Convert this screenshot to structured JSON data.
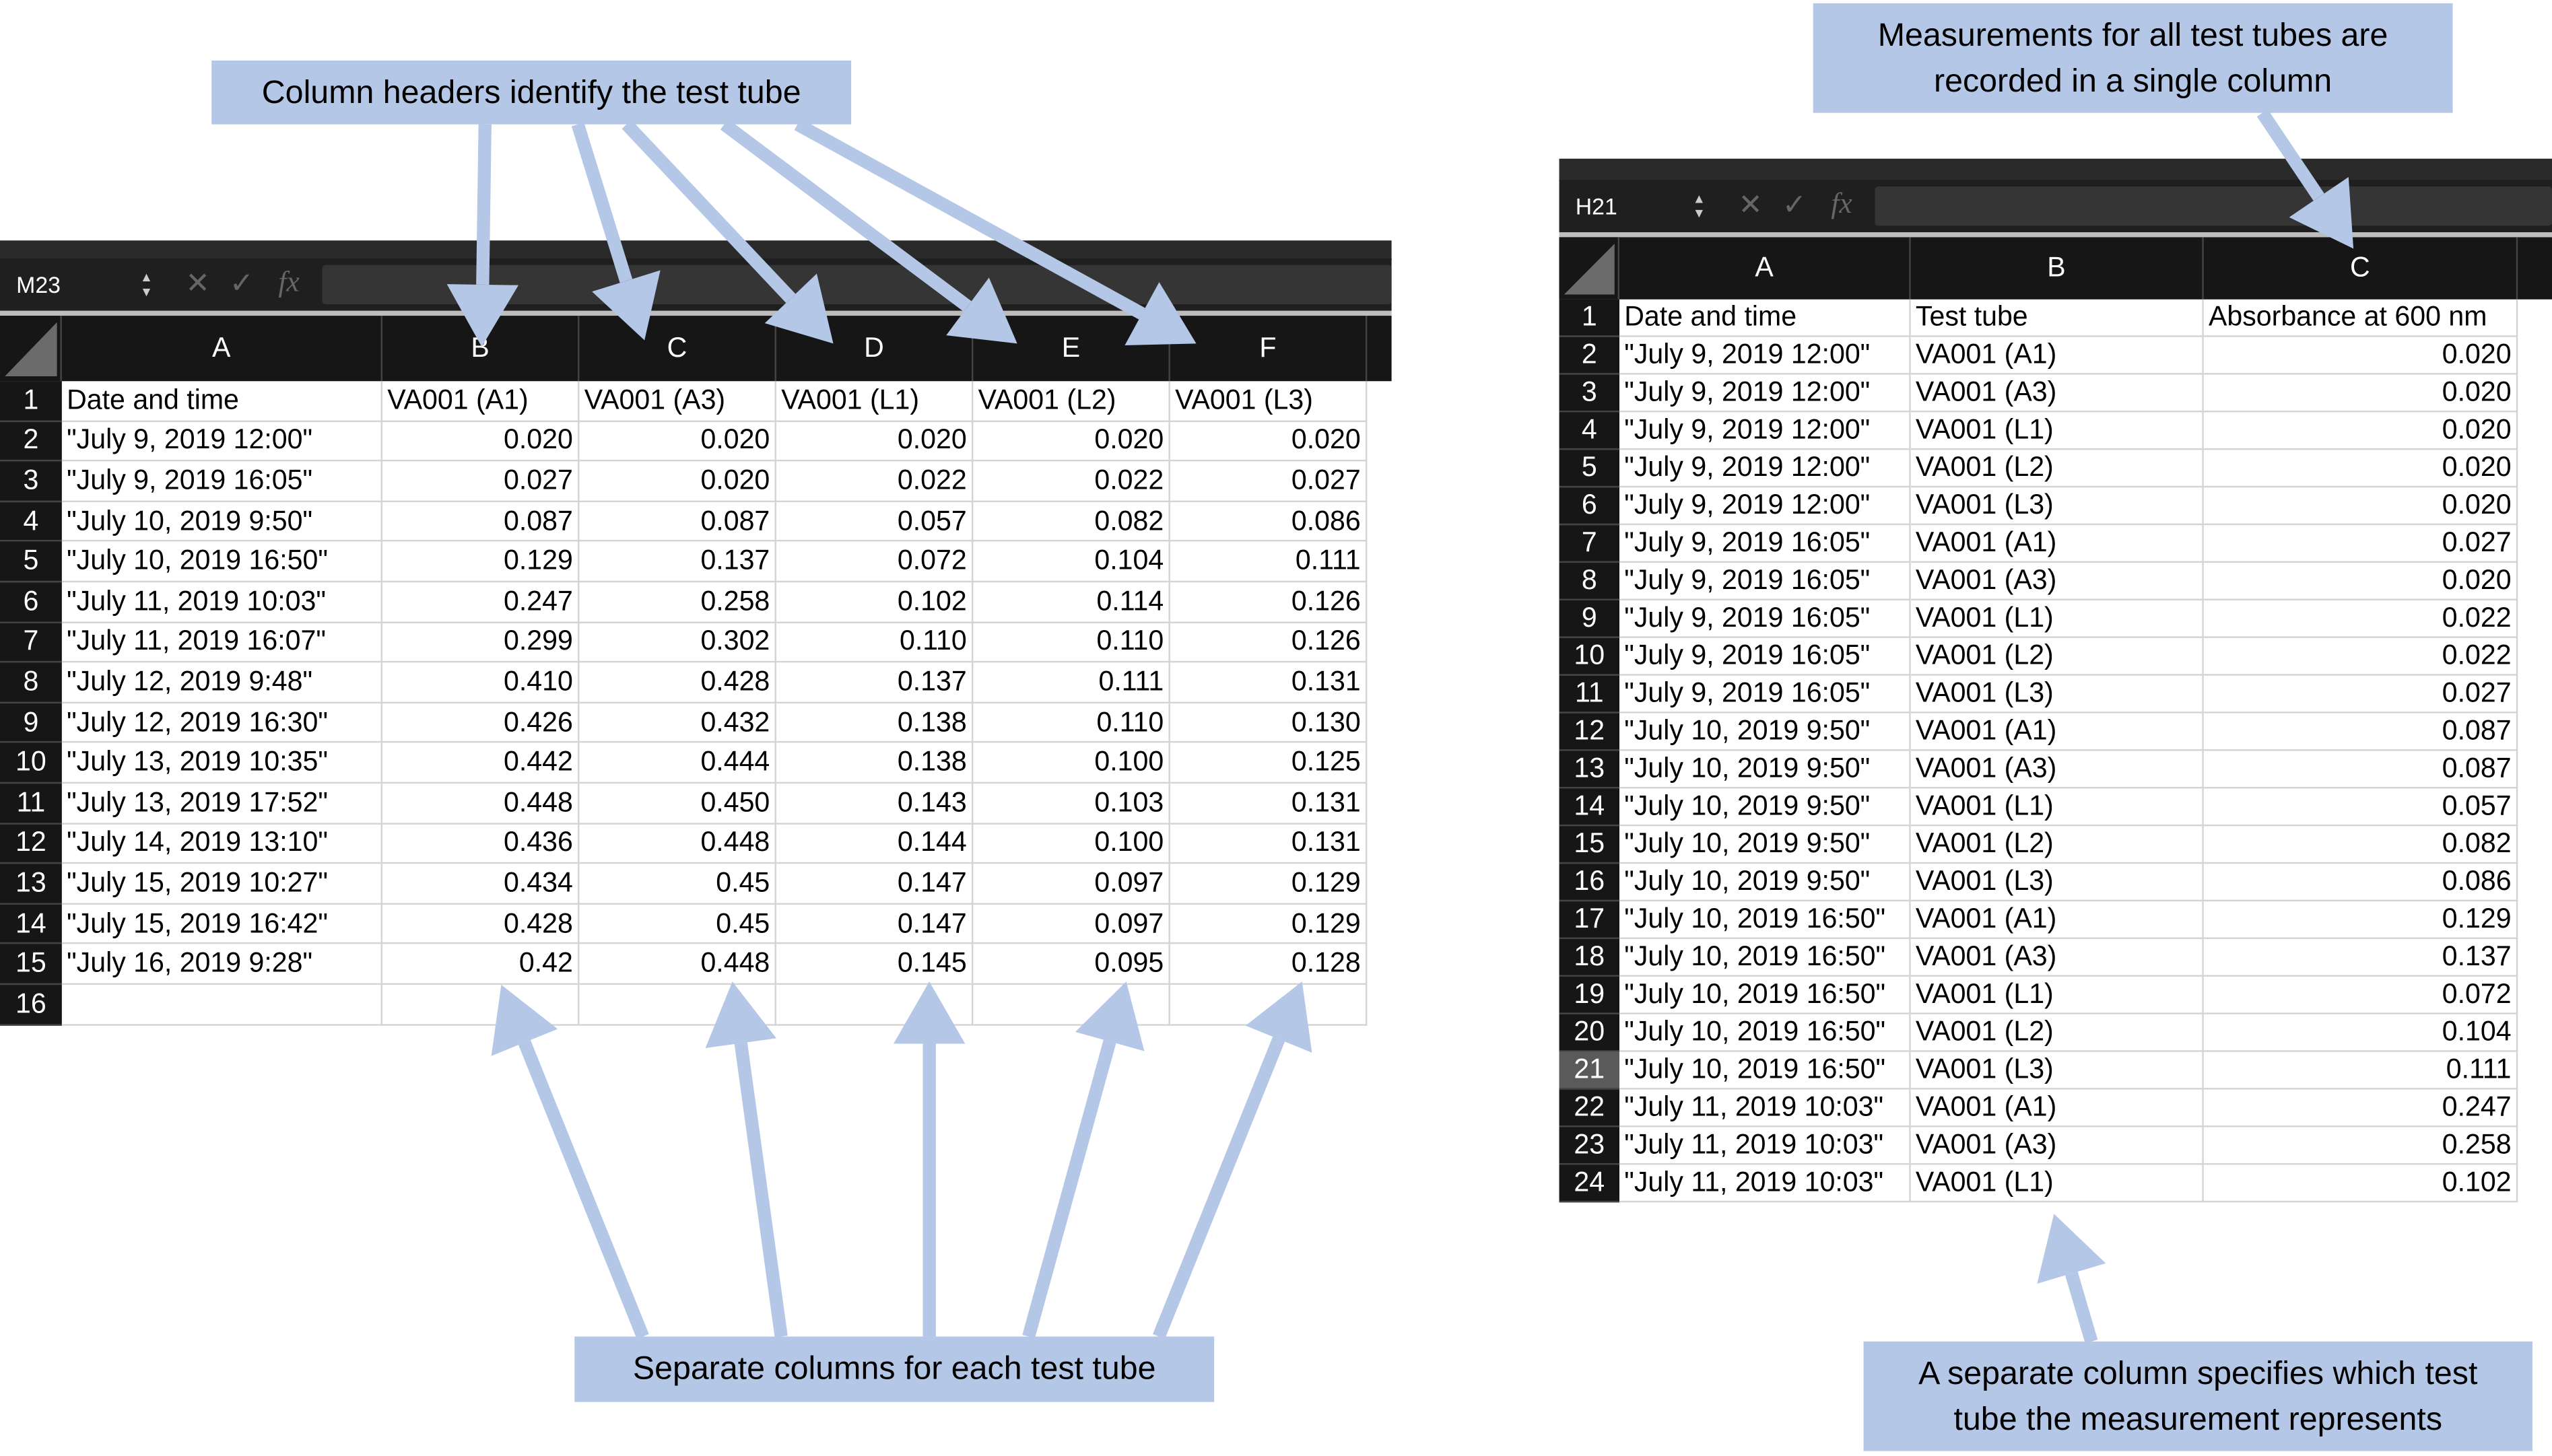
{
  "colors": {
    "callout": "#b4c7e7",
    "arrow": "#b4c7e7",
    "header_bg": "#161616",
    "selected_row": "#5a5a5a"
  },
  "formula_icons": {
    "cancel": "✕",
    "confirm": "✓",
    "fx": "fx",
    "stepper_up": "▲",
    "stepper_down": "▼"
  },
  "wide_sheet": {
    "name_box": "M23",
    "columns": [
      "A",
      "B",
      "C",
      "D",
      "E",
      "F"
    ],
    "rows": [
      {
        "n": "1",
        "cells": [
          "Date and time",
          "VA001 (A1)",
          "VA001 (A3)",
          "VA001 (L1)",
          "VA001 (L2)",
          "VA001 (L3)"
        ]
      },
      {
        "n": "2",
        "cells": [
          "\"July 9, 2019  12:00\"",
          "0.020",
          "0.020",
          "0.020",
          "0.020",
          "0.020"
        ]
      },
      {
        "n": "3",
        "cells": [
          "\"July 9, 2019 16:05\"",
          "0.027",
          "0.020",
          "0.022",
          "0.022",
          "0.027"
        ]
      },
      {
        "n": "4",
        "cells": [
          "\"July 10, 2019 9:50\"",
          "0.087",
          "0.087",
          "0.057",
          "0.082",
          "0.086"
        ]
      },
      {
        "n": "5",
        "cells": [
          "\"July 10, 2019 16:50\"",
          "0.129",
          "0.137",
          "0.072",
          "0.104",
          "0.111"
        ]
      },
      {
        "n": "6",
        "cells": [
          "\"July 11, 2019 10:03\"",
          "0.247",
          "0.258",
          "0.102",
          "0.114",
          "0.126"
        ]
      },
      {
        "n": "7",
        "cells": [
          "\"July 11, 2019 16:07\"",
          "0.299",
          "0.302",
          "0.110",
          "0.110",
          "0.126"
        ]
      },
      {
        "n": "8",
        "cells": [
          "\"July 12, 2019 9:48\"",
          "0.410",
          "0.428",
          "0.137",
          "0.111",
          "0.131"
        ]
      },
      {
        "n": "9",
        "cells": [
          "\"July 12, 2019 16:30\"",
          "0.426",
          "0.432",
          "0.138",
          "0.110",
          "0.130"
        ]
      },
      {
        "n": "10",
        "cells": [
          "\"July 13, 2019 10:35\"",
          "0.442",
          "0.444",
          "0.138",
          "0.100",
          "0.125"
        ]
      },
      {
        "n": "11",
        "cells": [
          "\"July 13, 2019 17:52\"",
          "0.448",
          "0.450",
          "0.143",
          "0.103",
          "0.131"
        ]
      },
      {
        "n": "12",
        "cells": [
          "\"July 14, 2019 13:10\"",
          "0.436",
          "0.448",
          "0.144",
          "0.100",
          "0.131"
        ]
      },
      {
        "n": "13",
        "cells": [
          "\"July 15, 2019 10:27\"",
          "0.434",
          "0.45",
          "0.147",
          "0.097",
          "0.129"
        ]
      },
      {
        "n": "14",
        "cells": [
          "\"July 15, 2019 16:42\"",
          "0.428",
          "0.45",
          "0.147",
          "0.097",
          "0.129"
        ]
      },
      {
        "n": "15",
        "cells": [
          "\"July 16, 2019 9:28\"",
          "0.42",
          "0.448",
          "0.145",
          "0.095",
          "0.128"
        ]
      },
      {
        "n": "16",
        "cells": [
          "",
          "",
          "",
          "",
          "",
          ""
        ]
      }
    ]
  },
  "long_sheet": {
    "name_box": "H21",
    "selected_row": "21",
    "columns": [
      "A",
      "B",
      "C"
    ],
    "rows": [
      {
        "n": "1",
        "cells": [
          "Date and time",
          "Test tube",
          "Absorbance at 600 nm"
        ]
      },
      {
        "n": "2",
        "cells": [
          "\"July 9, 2019  12:00\"",
          "VA001 (A1)",
          "0.020"
        ]
      },
      {
        "n": "3",
        "cells": [
          "\"July 9, 2019  12:00\"",
          "VA001 (A3)",
          "0.020"
        ]
      },
      {
        "n": "4",
        "cells": [
          "\"July 9, 2019  12:00\"",
          "VA001 (L1)",
          "0.020"
        ]
      },
      {
        "n": "5",
        "cells": [
          "\"July 9, 2019  12:00\"",
          "VA001 (L2)",
          "0.020"
        ]
      },
      {
        "n": "6",
        "cells": [
          "\"July 9, 2019  12:00\"",
          "VA001 (L3)",
          "0.020"
        ]
      },
      {
        "n": "7",
        "cells": [
          "\"July 9, 2019 16:05\"",
          "VA001 (A1)",
          "0.027"
        ]
      },
      {
        "n": "8",
        "cells": [
          "\"July 9, 2019 16:05\"",
          "VA001 (A3)",
          "0.020"
        ]
      },
      {
        "n": "9",
        "cells": [
          "\"July 9, 2019 16:05\"",
          "VA001 (L1)",
          "0.022"
        ]
      },
      {
        "n": "10",
        "cells": [
          "\"July 9, 2019 16:05\"",
          "VA001 (L2)",
          "0.022"
        ]
      },
      {
        "n": "11",
        "cells": [
          "\"July 9, 2019 16:05\"",
          "VA001 (L3)",
          "0.027"
        ]
      },
      {
        "n": "12",
        "cells": [
          "\"July 10, 2019 9:50\"",
          "VA001 (A1)",
          "0.087"
        ]
      },
      {
        "n": "13",
        "cells": [
          "\"July 10, 2019 9:50\"",
          "VA001 (A3)",
          "0.087"
        ]
      },
      {
        "n": "14",
        "cells": [
          "\"July 10, 2019 9:50\"",
          "VA001 (L1)",
          "0.057"
        ]
      },
      {
        "n": "15",
        "cells": [
          "\"July 10, 2019 9:50\"",
          "VA001 (L2)",
          "0.082"
        ]
      },
      {
        "n": "16",
        "cells": [
          "\"July 10, 2019 9:50\"",
          "VA001 (L3)",
          "0.086"
        ]
      },
      {
        "n": "17",
        "cells": [
          "\"July 10, 2019 16:50\"",
          "VA001 (A1)",
          "0.129"
        ]
      },
      {
        "n": "18",
        "cells": [
          "\"July 10, 2019 16:50\"",
          "VA001 (A3)",
          "0.137"
        ]
      },
      {
        "n": "19",
        "cells": [
          "\"July 10, 2019 16:50\"",
          "VA001 (L1)",
          "0.072"
        ]
      },
      {
        "n": "20",
        "cells": [
          "\"July 10, 2019 16:50\"",
          "VA001 (L2)",
          "0.104"
        ]
      },
      {
        "n": "21",
        "cells": [
          "\"July 10, 2019 16:50\"",
          "VA001 (L3)",
          "0.111"
        ]
      },
      {
        "n": "22",
        "cells": [
          "\"July 11, 2019 10:03\"",
          "VA001 (A1)",
          "0.247"
        ]
      },
      {
        "n": "23",
        "cells": [
          "\"July 11, 2019 10:03\"",
          "VA001 (A3)",
          "0.258"
        ]
      },
      {
        "n": "24",
        "cells": [
          "\"July 11, 2019 10:03\"",
          "VA001 (L1)",
          "0.102"
        ]
      }
    ]
  },
  "callouts": {
    "column_headers": "Column headers identify the test tube",
    "single_column": "Measurements for all test tubes are recorded in a single column",
    "separate_columns": "Separate columns for each test tube",
    "separate_column_specifies": "A separate column specifies which test tube the measurement represents"
  }
}
